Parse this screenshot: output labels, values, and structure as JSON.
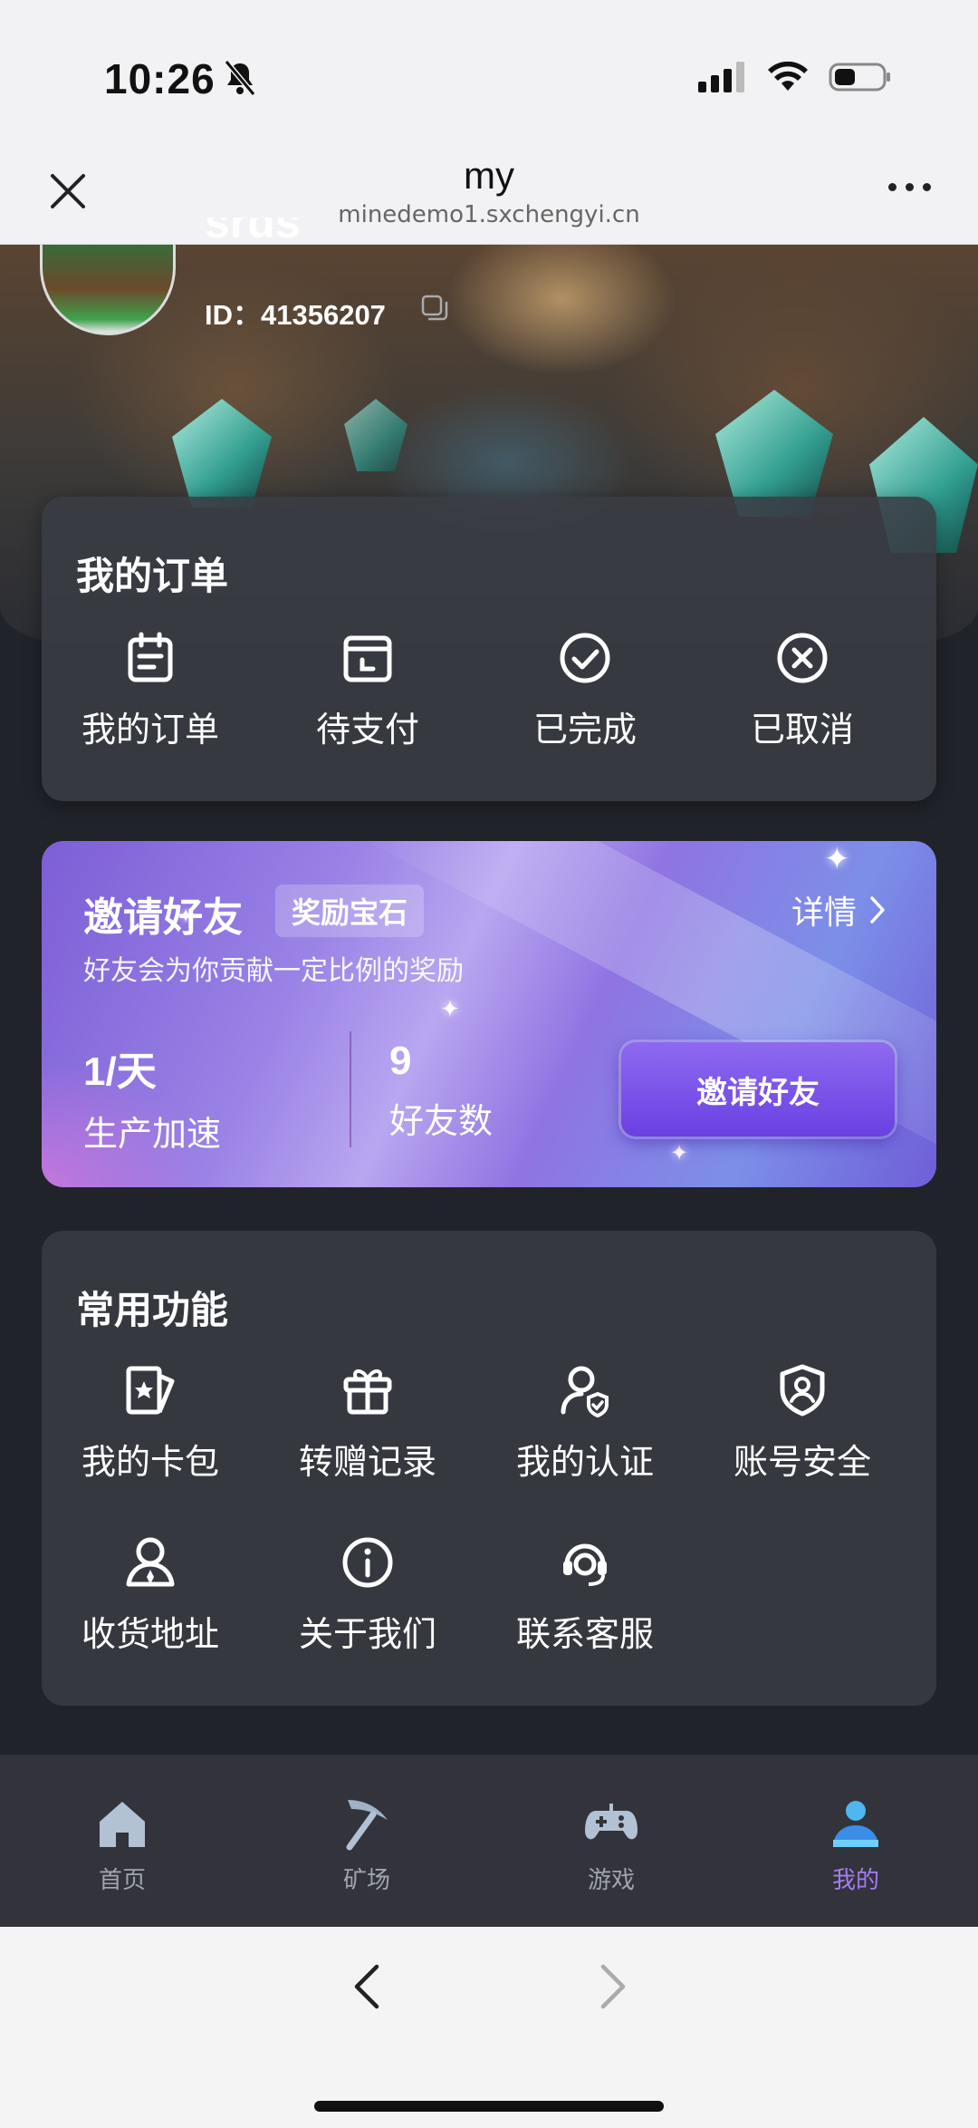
{
  "status_bar": {
    "time": "10:26"
  },
  "browser": {
    "title": "my",
    "url": "minedemo1.sxchengyi.cn"
  },
  "profile": {
    "username": "srds",
    "id_text": "ID：41356207"
  },
  "orders": {
    "title": "我的订单",
    "items": [
      {
        "label": "我的订单",
        "icon": "clipboard-icon"
      },
      {
        "label": "待支付",
        "icon": "wallet-icon"
      },
      {
        "label": "已完成",
        "icon": "check-circle-icon"
      },
      {
        "label": "已取消",
        "icon": "x-circle-icon"
      }
    ]
  },
  "invite": {
    "title": "邀请好友",
    "badge": "奖励宝石",
    "detail": "详情",
    "subtitle": "好友会为你贡献一定比例的奖励",
    "stats": [
      {
        "value": "1/天",
        "label": "生产加速"
      },
      {
        "value": "9",
        "label": "好友数"
      }
    ],
    "button": "邀请好友"
  },
  "functions": {
    "title": "常用功能",
    "items": [
      {
        "label": "我的卡包",
        "icon": "card-icon"
      },
      {
        "label": "转赠记录",
        "icon": "gift-icon"
      },
      {
        "label": "我的认证",
        "icon": "user-verified-icon"
      },
      {
        "label": "账号安全",
        "icon": "shield-user-icon"
      },
      {
        "label": "收货地址",
        "icon": "location-user-icon"
      },
      {
        "label": "关于我们",
        "icon": "info-icon"
      },
      {
        "label": "联系客服",
        "icon": "headset-icon"
      }
    ]
  },
  "tabs": [
    {
      "label": "首页",
      "icon": "home-icon"
    },
    {
      "label": "矿场",
      "icon": "pickaxe-icon"
    },
    {
      "label": "游戏",
      "icon": "gamepad-icon"
    },
    {
      "label": "我的",
      "icon": "profile-icon",
      "active": true
    }
  ],
  "colors": {
    "accent": "#a57cf0",
    "background": "#21232b",
    "card": "#363840"
  }
}
